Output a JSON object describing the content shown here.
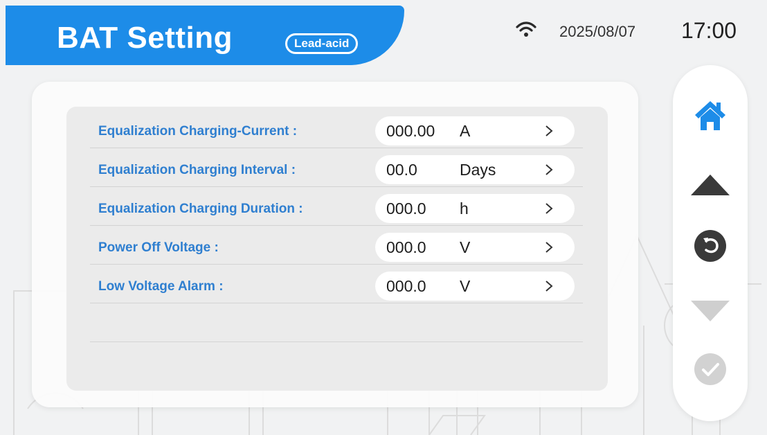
{
  "header": {
    "title": "BAT Setting",
    "mode_badge": "Lead-acid",
    "date": "2025/08/07",
    "time": "17:00"
  },
  "settings": [
    {
      "label": "Equalization Charging-Current :",
      "value": "000.00",
      "unit": "A"
    },
    {
      "label": "Equalization Charging Interval :",
      "value": "00.0",
      "unit": "Days"
    },
    {
      "label": "Equalization Charging Duration :",
      "value": "000.0",
      "unit": "h"
    },
    {
      "label": "Power Off  Voltage :",
      "value": "000.0",
      "unit": "V"
    },
    {
      "label": "Low Voltage Alarm :",
      "value": "000.0",
      "unit": "V"
    }
  ],
  "side_nav": [
    "home-icon",
    "arrow-up-icon",
    "return-icon",
    "arrow-down-icon",
    "confirm-check-icon"
  ],
  "colors": {
    "accent": "#1d8ce8",
    "label": "#2f7fd0",
    "disabled": "#cfcfcf",
    "dark_icon": "#3a3a3a"
  }
}
